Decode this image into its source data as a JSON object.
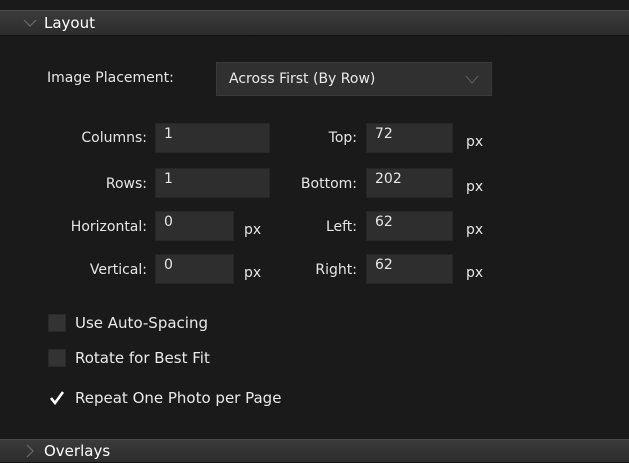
{
  "layout_section": {
    "title": "Layout",
    "image_placement": {
      "label": "Image Placement:",
      "value": "Across First (By Row)"
    },
    "fields": {
      "columns": {
        "label": "Columns:",
        "value": "1"
      },
      "rows": {
        "label": "Rows:",
        "value": "1"
      },
      "horizontal": {
        "label": "Horizontal:",
        "value": "0",
        "unit": "px"
      },
      "vertical": {
        "label": "Vertical:",
        "value": "0",
        "unit": "px"
      },
      "top": {
        "label": "Top:",
        "value": "72",
        "unit": "px"
      },
      "bottom": {
        "label": "Bottom:",
        "value": "202",
        "unit": "px"
      },
      "left": {
        "label": "Left:",
        "value": "62",
        "unit": "px"
      },
      "right": {
        "label": "Right:",
        "value": "62",
        "unit": "px"
      }
    },
    "checkboxes": {
      "auto_spacing": {
        "label": "Use Auto-Spacing",
        "checked": false
      },
      "rotate_best_fit": {
        "label": "Rotate for Best Fit",
        "checked": false
      },
      "repeat_one_photo": {
        "label": "Repeat One Photo per Page",
        "checked": true
      }
    }
  },
  "overlays_section": {
    "title": "Overlays"
  },
  "icons": {
    "layout_toggle": "chevron-down-icon",
    "overlays_toggle": "chevron-right-icon",
    "select_toggle": "chevron-down-icon",
    "check": "checkmark-icon"
  }
}
